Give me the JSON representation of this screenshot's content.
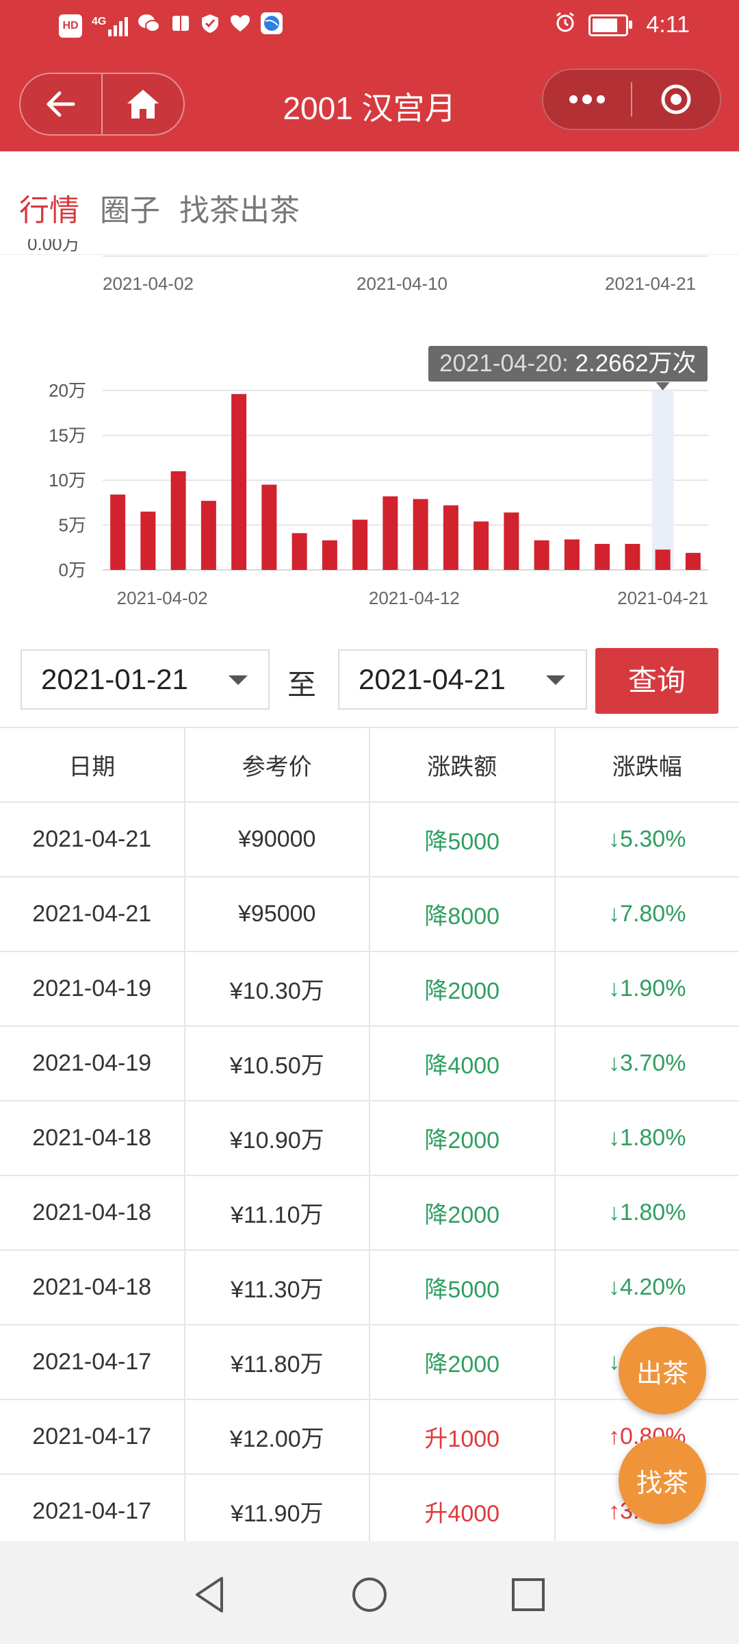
{
  "status_bar": {
    "left_icons": [
      "hd-icon",
      "signal-icon",
      "wechat-icon",
      "book-icon",
      "shield-icon",
      "heart-icon",
      "browser-icon"
    ],
    "hd_label": "HD",
    "network_label": "4G",
    "time": "4:11"
  },
  "header": {
    "title": "2001 汉宫月",
    "back_icon": "back-arrow-icon",
    "home_icon": "home-icon",
    "more_icon": "more-dots-icon",
    "target_icon": "target-icon"
  },
  "tabs": [
    {
      "label": "行情",
      "active": true
    },
    {
      "label": "圈子",
      "active": false
    },
    {
      "label": "找茶出茶",
      "active": false
    }
  ],
  "top_chart": {
    "partial_ylabel": "0.00万",
    "xticks": [
      "2021-04-02",
      "2021-04-10",
      "2021-04-21"
    ]
  },
  "chart_data": {
    "type": "bar",
    "title": "",
    "ylim": [
      0,
      20
    ],
    "yticks": [
      "0万",
      "5万",
      "10万",
      "15万",
      "20万"
    ],
    "xticks": [
      "2021-04-02",
      "2021-04-12",
      "2021-04-21"
    ],
    "values": [
      8.4,
      6.5,
      11.0,
      7.7,
      19.6,
      9.5,
      4.1,
      3.3,
      5.6,
      8.2,
      7.9,
      7.2,
      5.4,
      6.4,
      3.3,
      3.4,
      2.9,
      2.9,
      2.2662,
      1.9
    ],
    "highlight_index": 18,
    "tooltip_date": "2021-04-20:",
    "tooltip_value": "2.2662万次",
    "bar_color": "#d2222d",
    "grid": true
  },
  "filter": {
    "start_date": "2021-01-21",
    "to_label": "至",
    "end_date": "2021-04-21",
    "query_label": "查询"
  },
  "table": {
    "headers": [
      "日期",
      "参考价",
      "涨跌额",
      "涨跌幅"
    ],
    "rows": [
      {
        "date": "2021-04-21",
        "price": "¥90000",
        "change": "降5000",
        "pct": "↓5.30%",
        "dir": "down"
      },
      {
        "date": "2021-04-21",
        "price": "¥95000",
        "change": "降8000",
        "pct": "↓7.80%",
        "dir": "down"
      },
      {
        "date": "2021-04-19",
        "price": "¥10.30万",
        "change": "降2000",
        "pct": "↓1.90%",
        "dir": "down"
      },
      {
        "date": "2021-04-19",
        "price": "¥10.50万",
        "change": "降4000",
        "pct": "↓3.70%",
        "dir": "down"
      },
      {
        "date": "2021-04-18",
        "price": "¥10.90万",
        "change": "降2000",
        "pct": "↓1.80%",
        "dir": "down"
      },
      {
        "date": "2021-04-18",
        "price": "¥11.10万",
        "change": "降2000",
        "pct": "↓1.80%",
        "dir": "down"
      },
      {
        "date": "2021-04-18",
        "price": "¥11.30万",
        "change": "降5000",
        "pct": "↓4.20%",
        "dir": "down"
      },
      {
        "date": "2021-04-17",
        "price": "¥11.80万",
        "change": "降2000",
        "pct": "↓1.70%",
        "dir": "down"
      },
      {
        "date": "2021-04-17",
        "price": "¥12.00万",
        "change": "升1000",
        "pct": "↑0.80%",
        "dir": "up"
      },
      {
        "date": "2021-04-17",
        "price": "¥11.90万",
        "change": "升4000",
        "pct": "↑3.50%",
        "dir": "up"
      }
    ]
  },
  "fab": {
    "sell_label": "出茶",
    "find_label": "找茶"
  },
  "system_nav": {
    "back_icon": "nav-back-icon",
    "home_icon": "nav-home-icon",
    "recents_icon": "nav-recents-icon"
  }
}
